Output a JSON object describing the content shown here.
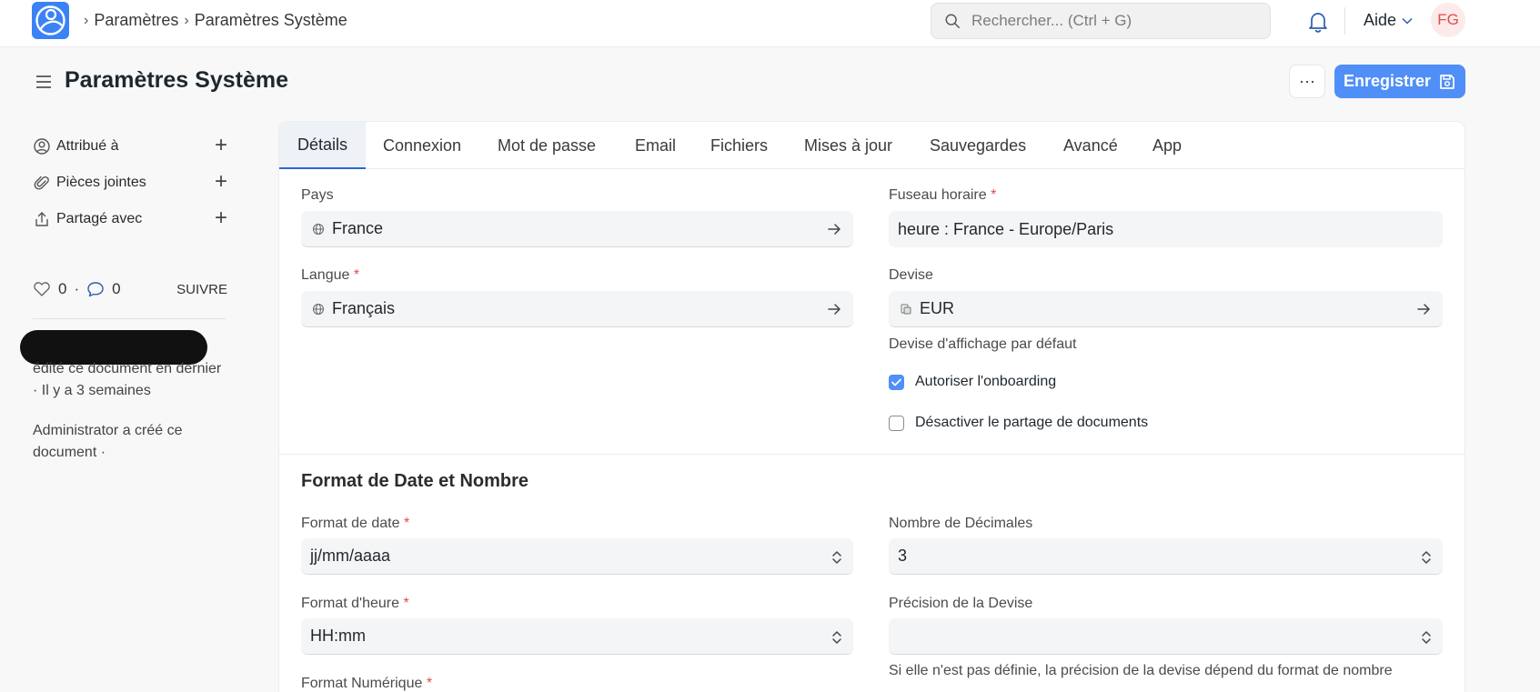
{
  "navbar": {
    "breadcrumbs": [
      "Paramètres",
      "Paramètres Système"
    ],
    "search_placeholder": "Rechercher... (Ctrl + G)",
    "help_label": "Aide",
    "avatar_initials": "FG"
  },
  "page": {
    "title": "Paramètres Système",
    "more_label": "···",
    "save_label": "Enregistrer"
  },
  "sidebar": {
    "items": [
      {
        "label": "Attribué à",
        "icon": "user-assign-icon"
      },
      {
        "label": "Pièces jointes",
        "icon": "paperclip-icon"
      },
      {
        "label": "Partagé avec",
        "icon": "share-icon"
      }
    ],
    "likes_count": "0",
    "dot": "·",
    "comments_count": "0",
    "follow_label": "SUIVRE",
    "activity": [
      "édité ce document en dernier · Il y a 3 semaines",
      "Administrator a créé ce document ·"
    ]
  },
  "tabs": [
    "Détails",
    "Connexion",
    "Mot de passe",
    "Email",
    "Fichiers",
    "Mises à jour",
    "Sauvegardes",
    "Avancé",
    "App"
  ],
  "form": {
    "country": {
      "label": "Pays",
      "value": "France"
    },
    "timezone": {
      "label": "Fuseau horaire",
      "value": "heure : France - Europe/Paris"
    },
    "language": {
      "label": "Langue",
      "value": "Français"
    },
    "currency": {
      "label": "Devise",
      "value": "EUR",
      "help": "Devise d'affichage par défaut"
    },
    "enable_onboarding": {
      "label": "Autoriser l'onboarding",
      "checked": true
    },
    "disable_doc_sharing": {
      "label": "Désactiver le partage de documents",
      "checked": false
    },
    "required_mark": "*",
    "section_title": "Format de Date et Nombre",
    "date_format": {
      "label": "Format de date",
      "value": "jj/mm/aaaa"
    },
    "float_precision": {
      "label": "Nombre de Décimales",
      "value": "3"
    },
    "time_format": {
      "label": "Format d'heure",
      "value": "HH:mm"
    },
    "currency_precision": {
      "label": "Précision de la Devise",
      "value": "",
      "help": "Si elle n'est pas définie, la précision de la devise dépend du format de nombre"
    },
    "number_format": {
      "label": "Format Numérique"
    }
  },
  "colors": {
    "accent": "#4f8ff7",
    "required": "#e5484d",
    "avatar_text": "#e24c4c"
  }
}
